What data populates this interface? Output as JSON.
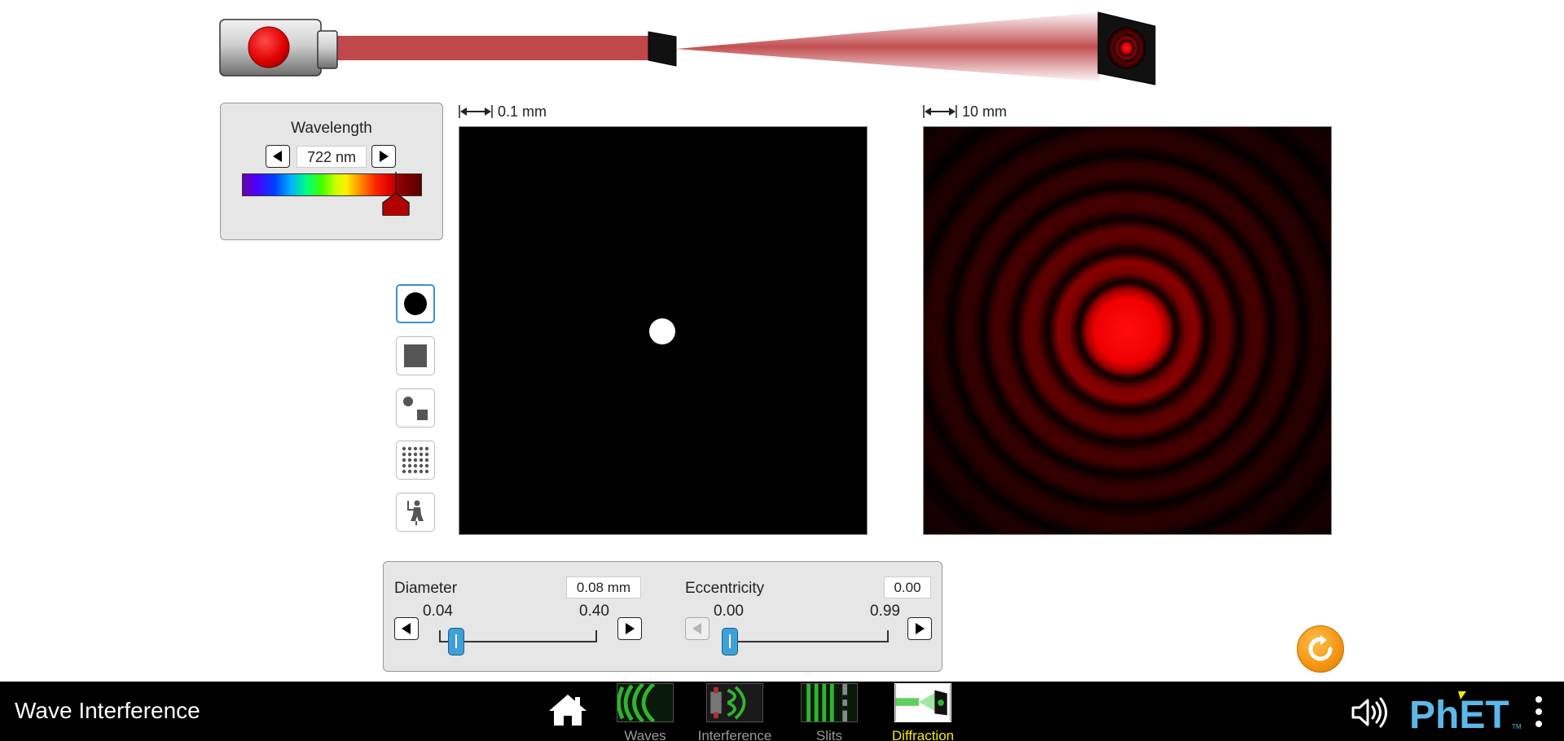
{
  "app": {
    "title": "Wave Interference"
  },
  "wavelength": {
    "title": "Wavelength",
    "value_label": "722 nm",
    "min_nm": 380,
    "max_nm": 780,
    "value_nm": 722,
    "thumb_color": "#b30000"
  },
  "apertures": {
    "options": [
      "circle-icon",
      "square-icon",
      "disk-and-square-icon",
      "dot-grid-icon",
      "custom-figure-icon"
    ],
    "selected": "circle-icon"
  },
  "scales": {
    "aperture": "0.1 mm",
    "pattern": "10 mm"
  },
  "diameter": {
    "label": "Diameter",
    "value_label": "0.08 mm",
    "min_label": "0.04",
    "max_label": "0.40",
    "min": 0.04,
    "max": 0.4,
    "value": 0.08
  },
  "eccentricity": {
    "label": "Eccentricity",
    "value_label": "0.00",
    "min_label": "0.00",
    "max_label": "0.99",
    "min": 0.0,
    "max": 0.99,
    "value": 0.0
  },
  "navbar": {
    "screens": [
      {
        "label": "Waves",
        "active": false
      },
      {
        "label": "Interference",
        "active": false
      },
      {
        "label": "Slits",
        "active": false
      },
      {
        "label": "Diffraction",
        "active": true
      }
    ]
  },
  "colors": {
    "laser_red": "#e00000",
    "beam": "#c0474a",
    "slider_blue": "#3ea0d8",
    "active_tab": "#f2e916",
    "selected_outline": "#3d8fd6",
    "reset_orange": "#f39512",
    "phet_blue": "#5bb8e8"
  }
}
